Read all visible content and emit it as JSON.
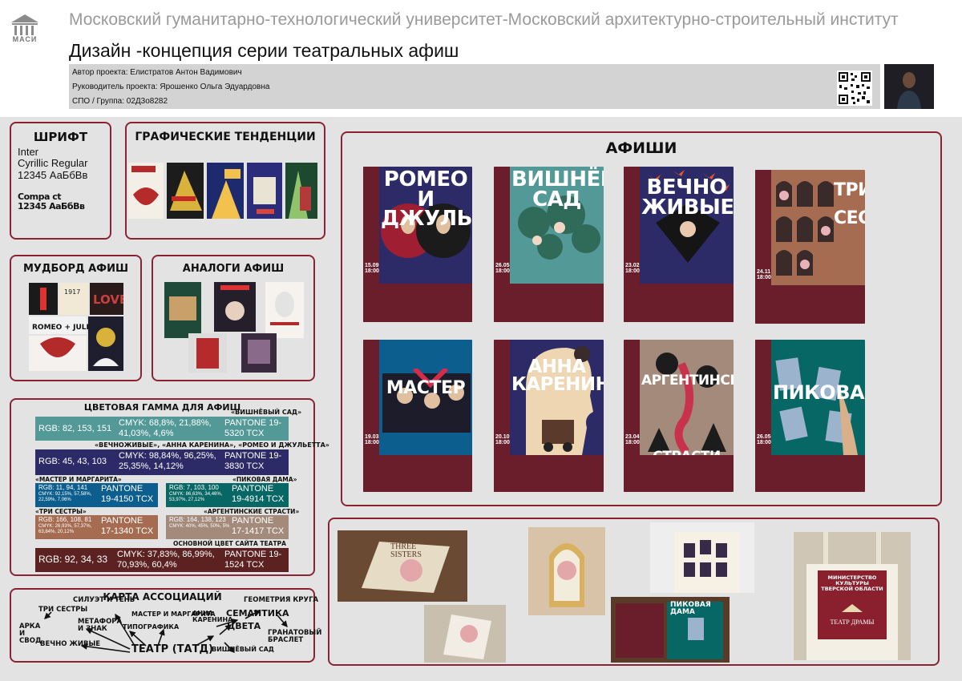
{
  "header": {
    "logo": "МАСИ",
    "university": "Московский гуманитарно-технологический университет-Московский архитектурно-строительный институт",
    "title": "Дизайн -концепция серии театральных афиш",
    "author": "Автор проекта: Елистратов Антон Вадимович",
    "supervisor": "Руководитель проекта: Ярошенко Ольга Эдуардовна",
    "group": "СПО / Группа: 02Д3о8282"
  },
  "font": {
    "heading": "ШРИФТ",
    "line1": "Inter",
    "line2": "Cyrillic Regular",
    "line3": "12345 АаБбВв",
    "line4": "Compa ct",
    "line5": "12345 АаБбВв"
  },
  "trends": {
    "heading": "ГРАФИЧЕСКИЕ ТЕНДЕНЦИИ"
  },
  "moodboard": {
    "heading": "МУДБОРД АФИШ"
  },
  "analogs": {
    "heading": "АНАЛОГИ АФИШ"
  },
  "palette": {
    "heading": "ЦВЕТОВАЯ ГАММА ДЛЯ АФИШ",
    "rows": [
      {
        "label": "«ВИШНЁВЫЙ САД»",
        "rgb": "RGB: 82, 153, 151",
        "cmyk": "CMYK: 68,8%, 21,88%, 41,03%, 4,6%",
        "pantone": "PANTONE 19-5320 TCX",
        "color": "#529997"
      },
      {
        "label": "«ВЕЧНОЖИВЫЕ», «АННА КАРЕНИНА», «РОМЕО И ДЖУЛЬЕТТА»",
        "rgb": "RGB: 45, 43, 103",
        "cmyk": "CMYK: 98,84%, 96,25%, 25,35%, 14,12%",
        "pantone": "PANTONE 19-3830 TCX",
        "color": "#2d2b67"
      },
      {
        "label": "«МАСТЕР И МАРГАРИТА»",
        "rgb": "RGB: 11, 94, 141",
        "cmyk": "CMYK: 92,15%, 57,58%, 22,59%, 7,06%",
        "pantone": "PANTONE 19-4150 TCX",
        "color": "#0b5e8d"
      },
      {
        "label": "«ПИКОВАЯ ДАМА»",
        "rgb": "RGB: 7, 103, 100",
        "cmyk": "CMYK: 86,63%, 34,46%, 53,97%, 27,12%",
        "pantone": "PANTONE 19-4914 TCX",
        "color": "#076764"
      },
      {
        "label": "«ТРИ СЕСТРЫ»",
        "rgb": "RGB: 166, 108, 81",
        "cmyk": "CMYK: 26,93%, 57,37%, 63,84%, 20,12%",
        "pantone": "PANTONE 17-1340 TCX",
        "color": "#a66c51"
      },
      {
        "label": "«АРГЕНТИНСКИЕ СТРАСТИ»",
        "rgb": "RGB: 164, 138, 123",
        "cmyk": "CMYK: 40%, 45%, 50%, 5%",
        "pantone": "PANTONE 17-1417 TCX",
        "color": "#a48a7b"
      },
      {
        "label": "ОСНОВНОЙ ЦВЕТ САЙТА ТЕАТРА",
        "rgb": "RGB: 92, 34, 33",
        "cmyk": "CMYK: 37,83%, 86,99%, 70,93%, 60,4%",
        "pantone": "PANTONE 19-1524 TCX",
        "color": "#5c2221"
      }
    ]
  },
  "association_map": {
    "heading": "КАРТА АССОЦИАЦИЙ",
    "words": {
      "three_sisters": "ТРИ СЕСТРЫ",
      "arch": "АРКА И СВОД",
      "evergreen": "ВЕЧНО ЖИВЫЕ",
      "silhouette": "СИЛУЭТ И ТЕНЬ",
      "metaphor": "МЕТАФОРА И ЗНАК",
      "typography": "ТИПОГРАФИКА",
      "master": "МАСТЕР И МАРГАРИТА",
      "anna": "АННА КАРЕНИНА",
      "semantics": "СЕМАНТИКА",
      "circle": "ГЕОМЕТРИЯ КРУГА",
      "colors": "ЦВЕТА",
      "bracelet": "ГРАНАТОВЫЙ БРАСЛЕТ",
      "garden": "ВИШНЁВЫЙ САД",
      "theatre": "ТЕАТР (ТАТД)"
    }
  },
  "posters": {
    "heading": "АФИШИ",
    "items": [
      {
        "title": "РОМЕО И ДЖУЛЬЕТТА",
        "date": "15.09 18:00",
        "bg": "#2d2b67",
        "side": "#6a1e2c",
        "foot": "#6a1e2c"
      },
      {
        "title": "ВИШНЁВЫЙ САД",
        "date": "26.05 18:00",
        "bg": "#529997",
        "side": "#6a1e2c",
        "foot": "#6a1e2c"
      },
      {
        "title": "ВЕЧНО ЖИВЫЕ",
        "date": "23.02 18:00",
        "bg": "#2d2b67",
        "side": "#6a1e2c",
        "foot": "#6a1e2c"
      },
      {
        "title": "ТРИ СЕСТРЫ",
        "date": "24.11 18:00",
        "bg": "#a66c51",
        "side": "#6a1e2c",
        "foot": "#6a1e2c"
      },
      {
        "title": "МАСТЕР И МАРГАРИТА",
        "date": "19.03 18:00",
        "bg": "#0b5e8d",
        "side": "#6a1e2c",
        "foot": "#6a1e2c"
      },
      {
        "title": "АННА КАРЕНИНА",
        "date": "20.10 18:00",
        "bg": "#2d2b67",
        "side": "#6a1e2c",
        "foot": "#6a1e2c"
      },
      {
        "title": "АРГЕНТИНСКИЕ СТРАСТИ",
        "date": "23.04 18:00",
        "bg": "#a48a7b",
        "side": "#6a1e2c",
        "foot": "#6a1e2c"
      },
      {
        "title": "ПИКОВАЯ ДАМА",
        "date": "26.05 18:00",
        "bg": "#076764",
        "side": "#6a1e2c",
        "foot": "#6a1e2c"
      }
    ]
  },
  "mockups": {
    "book_title": "THREE SISTERS",
    "bag_text": "МИНИСТЕРСТВО КУЛЬТУРЫ ТВЕРСКОЙ ОБЛАСТИ",
    "bag_text2": "ТЕАТР ДРАМЫ",
    "booklet_title": "ПИКОВАЯ ДАМА"
  },
  "colors": {
    "accent": "#8a2434",
    "bg": "#e3e3e3"
  }
}
